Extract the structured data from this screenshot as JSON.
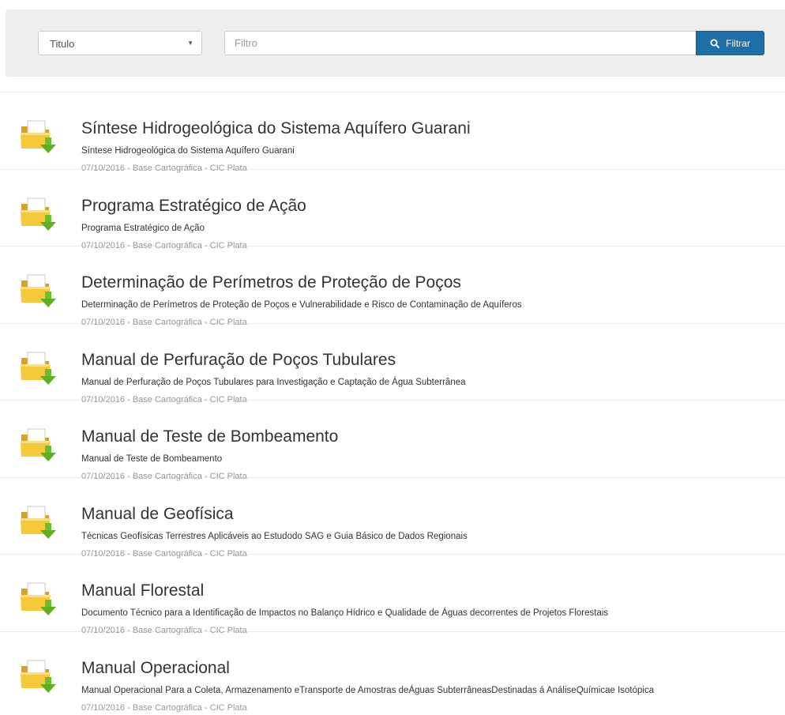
{
  "filter": {
    "field_select": {
      "value": "Titulo"
    },
    "input": {
      "placeholder": "Filtro",
      "value": ""
    },
    "button_label": "Filtrar",
    "button_color": "#1e6fa5"
  },
  "items": [
    {
      "title": "Síntese Hidrogeológica do Sistema Aquífero Guarani",
      "description": "Síntese Hidrogeológica do Sistema Aquífero Guarani",
      "meta": "07/10/2016 - Base Cartográfica - CIC Plata"
    },
    {
      "title": "Programa Estratégico de Ação",
      "description": "Programa Estratégico de Ação",
      "meta": "07/10/2016 - Base Cartográfica - CIC Plata"
    },
    {
      "title": "Determinação de Perímetros de Proteção de Poços",
      "description": "Determinação de Perímetros de Proteção de Poços e Vulnerabilidade e Risco de Contaminação de Aquíferos",
      "meta": "07/10/2016 - Base Cartográfica - CIC Plata"
    },
    {
      "title": "Manual de Perfuração de Poços Tubulares",
      "description": "Manual de Perfuração de Poços Tubulares para Investigação e Captação de Água Subterrânea",
      "meta": "07/10/2016 - Base Cartográfica - CIC Plata"
    },
    {
      "title": "Manual de Teste de Bombeamento",
      "description": "Manual de Teste de Bombeamento",
      "meta": "07/10/2016 - Base Cartográfica - CIC Plata"
    },
    {
      "title": "Manual de Geofísica",
      "description": "Técnicas Geofísicas Terrestres Aplicáveis ao Estudodo SAG e Guia Básico de Dados Regionais",
      "meta": "07/10/2016 - Base Cartográfica - CIC Plata"
    },
    {
      "title": "Manual Florestal",
      "description": "Documento Técnico para a Identificação de Impactos no Balanço Hídrico e Qualidade de Águas decorrentes de Projetos Florestais",
      "meta": "07/10/2016 - Base Cartográfica - CIC Plata"
    },
    {
      "title": "Manual Operacional",
      "description": "Manual Operacional Para a Coleta, Armazenamento eTransporte de Amostras deÁguas SubterrâneasDestinadas á AnáliseQuímicae Isotópica",
      "meta": "07/10/2016 - Base Cartográfica - CIC Plata"
    }
  ],
  "icons": {
    "item_icon": "folder-download-icon",
    "search": "search-icon",
    "caret": "caret-down-icon"
  }
}
